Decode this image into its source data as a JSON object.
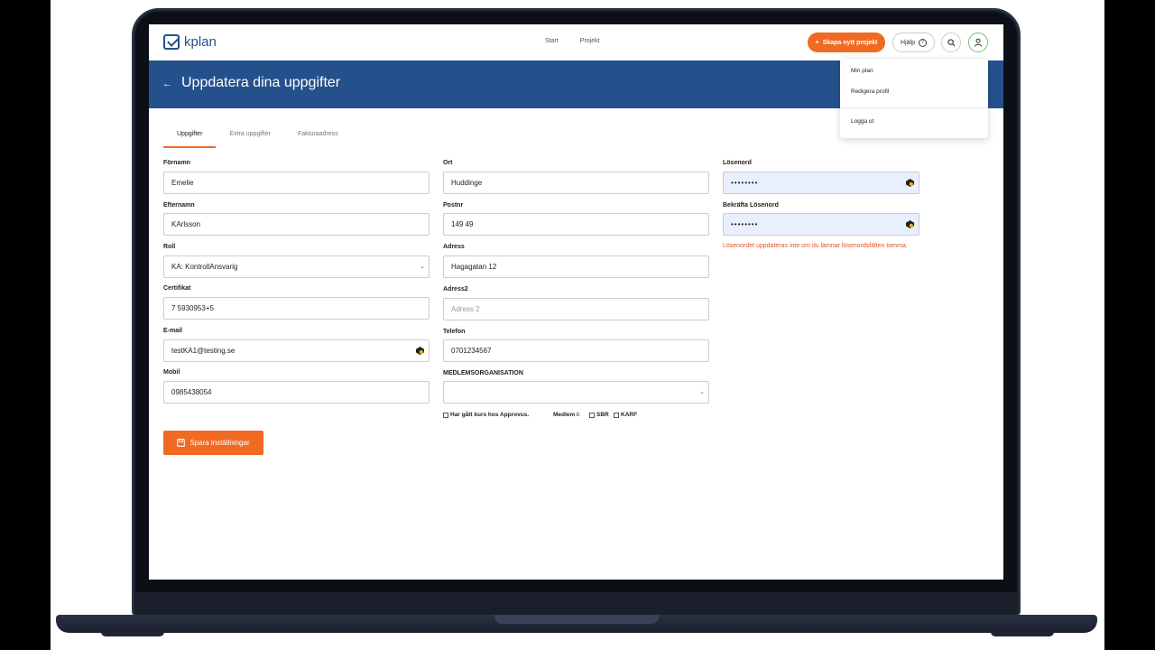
{
  "app": {
    "logo_text": "kplan"
  },
  "nav": {
    "start": "Start",
    "projects": "Projekt"
  },
  "header": {
    "new_project": "Skapa nytt projekt",
    "help": "Hjälp",
    "help_icon": "?"
  },
  "banner": {
    "back": "←",
    "title": "Uppdatera dina uppgifter"
  },
  "dropdown": {
    "items": [
      "Min plan",
      "Redigera profil",
      "Logga ut"
    ]
  },
  "tabs": [
    "Uppgifter",
    "Extra uppgifter",
    "Fakturaadress"
  ],
  "col1": {
    "firstname_label": "Förnamn",
    "firstname": "Emelie",
    "lastname_label": "Efternamn",
    "lastname": "KArlsson",
    "role_label": "Roll",
    "role": "KA: KontrollAnsvarig",
    "cert_label": "Certifikat",
    "cert": "7 5930953+5",
    "email_label": "E-mail",
    "email": "testKA1@testing.se",
    "mobile_label": "Mobil",
    "mobile": "0985438054"
  },
  "col2": {
    "city_label": "Ort",
    "city": "Huddinge",
    "zip_label": "Postnr",
    "zip": "149 49",
    "address_label": "Adress",
    "address": "Hagagatan 12",
    "address2_label": "Adress2",
    "address2_placeholder": "Adress 2",
    "phone_label": "Telefon",
    "phone": "0701234567",
    "org_label": "MEDLEMSORGANISATION",
    "org": ""
  },
  "col3": {
    "password_label": "Lösenord",
    "password": "••••••••",
    "confirm_label": "Bekräfta Lösenord",
    "confirm": "••••••••",
    "warning": "Lösenordet uppdateras inte om du lämnar lösenordsfälten tomma."
  },
  "checks": {
    "course": "Har gått kurs hos Approvus.",
    "member_label": "Medlem i:",
    "sbr": "SBR",
    "karf": "KARF"
  },
  "save_button": "Spara inställningar",
  "colors": {
    "primary": "#24518c",
    "accent": "#f06a24"
  }
}
